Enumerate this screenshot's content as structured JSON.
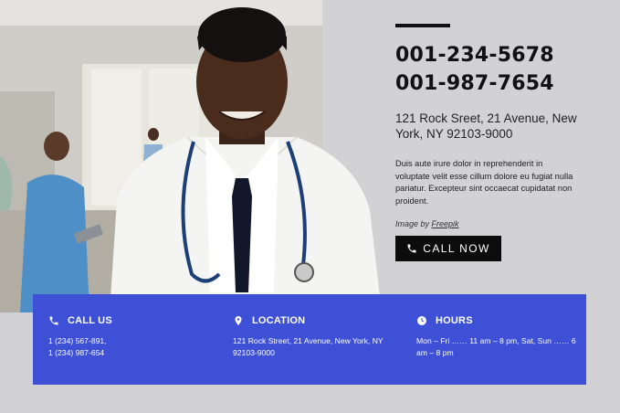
{
  "hero": {
    "phones": [
      "001-234-5678",
      "001-987-7654"
    ],
    "address": "121 Rock Sreet, 21 Avenue, New York, NY 92103-9000",
    "description": "Duis aute irure dolor in reprehenderit in voluptate velit esse cillum dolore eu fugiat nulla pariatur. Excepteur sint occaecat cupidatat non proident.",
    "credit_prefix": "Image by",
    "credit_link": "Freepik",
    "call_button": "CALL NOW"
  },
  "contact_bar": {
    "background": "#3d50d6",
    "columns": [
      {
        "icon": "phone-icon",
        "title": "CALL US",
        "lines": [
          "1 (234) 567-891,",
          "1 (234) 987-654"
        ]
      },
      {
        "icon": "location-pin-icon",
        "title": "LOCATION",
        "lines": [
          "121 Rock Street, 21 Avenue, New York, NY",
          "92103-9000"
        ]
      },
      {
        "icon": "clock-icon",
        "title": "HOURS",
        "lines": [
          "Mon – Fri …… 11 am – 8 pm, Sat, Sun …… 6",
          "am – 8 pm"
        ]
      }
    ]
  }
}
